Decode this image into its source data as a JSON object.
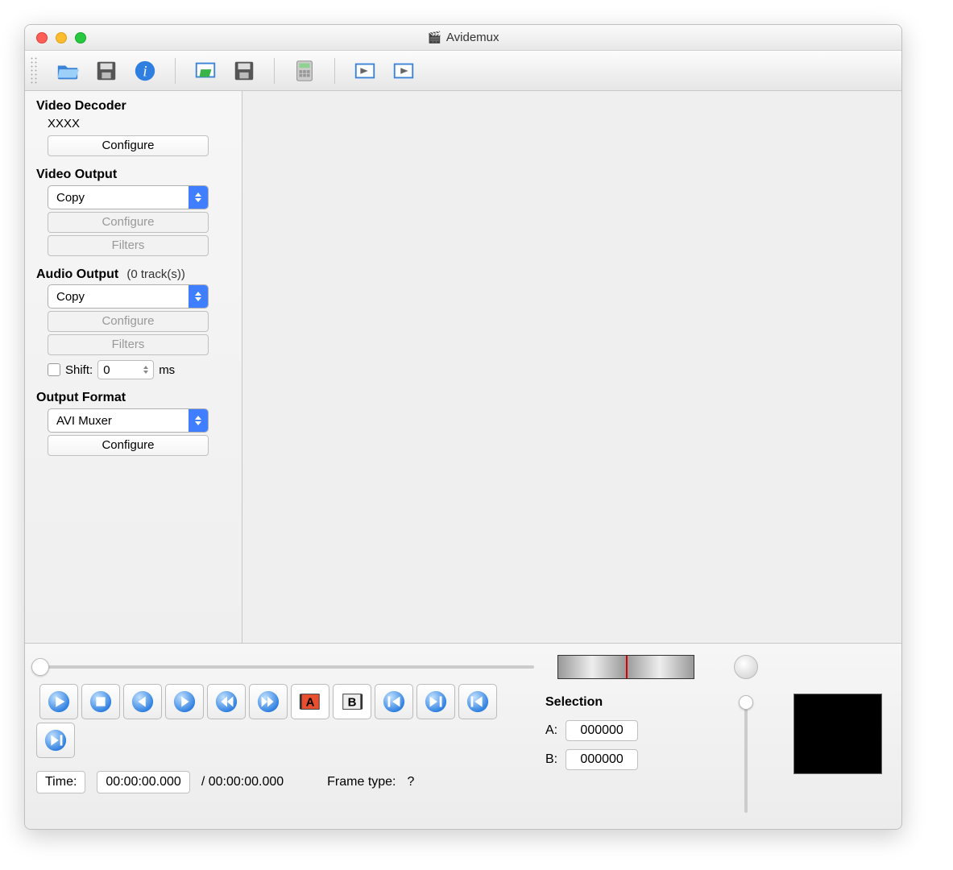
{
  "window": {
    "title": "Avidemux"
  },
  "toolbar": {
    "open": "open-file",
    "save": "save-file",
    "info": "file-info",
    "folder_open": "open-folder",
    "folder_save": "save-project",
    "calculator": "calculator",
    "mark_in_tool": "marker-in",
    "mark_out_tool": "marker-out"
  },
  "sidebar": {
    "video_decoder": {
      "title": "Video Decoder",
      "name": "XXXX",
      "configure": "Configure"
    },
    "video_output": {
      "title": "Video Output",
      "codec": "Copy",
      "configure": "Configure",
      "filters": "Filters"
    },
    "audio_output": {
      "title": "Audio Output",
      "tracks": "(0 track(s))",
      "codec": "Copy",
      "configure": "Configure",
      "filters": "Filters",
      "shift_label": "Shift:",
      "shift_value": "0",
      "shift_unit": "ms"
    },
    "output_format": {
      "title": "Output Format",
      "muxer": "AVI Muxer",
      "configure": "Configure"
    }
  },
  "playback": {
    "time_label": "Time:",
    "time_value": "00:00:00.000",
    "time_duration": "/ 00:00:00.000",
    "frame_type_label": "Frame type:",
    "frame_type_value": "?"
  },
  "selection": {
    "title": "Selection",
    "a_label": "A:",
    "a_value": "000000",
    "b_label": "B:",
    "b_value": "000000"
  }
}
